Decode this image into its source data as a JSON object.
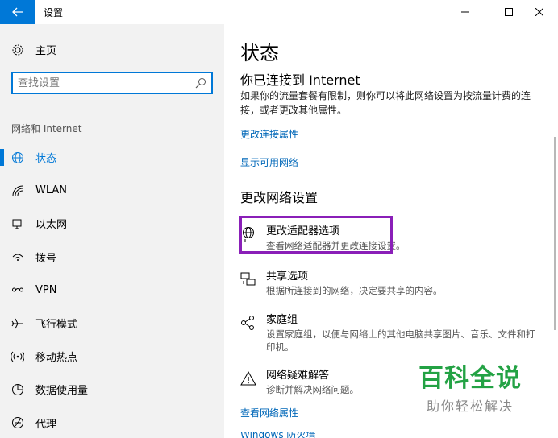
{
  "window": {
    "title": "设置",
    "back_glyph": "←",
    "min_glyph": "—",
    "max_glyph": "☐",
    "close_glyph": "✕"
  },
  "sidebar": {
    "home_label": "主页",
    "search_placeholder": "查找设置",
    "section_label": "网络和 Internet",
    "items": [
      {
        "label": "状态",
        "icon": "globe-icon",
        "active": true
      },
      {
        "label": "WLAN",
        "icon": "wifi-icon",
        "active": false
      },
      {
        "label": "以太网",
        "icon": "ethernet-icon",
        "active": false
      },
      {
        "label": "拨号",
        "icon": "dialup-icon",
        "active": false
      },
      {
        "label": "VPN",
        "icon": "vpn-icon",
        "active": false
      },
      {
        "label": "飞行模式",
        "icon": "airplane-icon",
        "active": false
      },
      {
        "label": "移动热点",
        "icon": "hotspot-icon",
        "active": false
      },
      {
        "label": "数据使用量",
        "icon": "data-usage-icon",
        "active": false
      },
      {
        "label": "代理",
        "icon": "proxy-icon",
        "active": false
      }
    ]
  },
  "main": {
    "title": "状态",
    "connected_heading": "你已连接到 Internet",
    "connected_desc": "如果你的流量套餐有限制，则你可以将此网络设置为按流量计费的连接，或者更改其他属性。",
    "link_change_props": "更改连接属性",
    "link_show_networks": "显示可用网络",
    "change_heading": "更改网络设置",
    "options": [
      {
        "title": "更改适配器选项",
        "desc": "查看网络适配器并更改连接设置。",
        "icon": "adapter-icon"
      },
      {
        "title": "共享选项",
        "desc": "根据所连接到的网络，决定要共享的内容。",
        "icon": "sharing-icon"
      },
      {
        "title": "家庭组",
        "desc": "设置家庭组，以便与网络上的其他电脑共享图片、音乐、文件和打印机。",
        "icon": "homegroup-icon"
      },
      {
        "title": "网络疑难解答",
        "desc": "诊断并解决网络问题。",
        "icon": "warning-icon"
      }
    ],
    "link_view_props": "查看网络属性",
    "link_cut": "Windows 防火墙"
  },
  "watermark": {
    "big": "百科全说",
    "small": "助你轻松解决"
  },
  "colors": {
    "accent": "#0078d7",
    "link": "#0067b8",
    "highlight": "#8a1fb8",
    "watermark": "#23a244"
  }
}
